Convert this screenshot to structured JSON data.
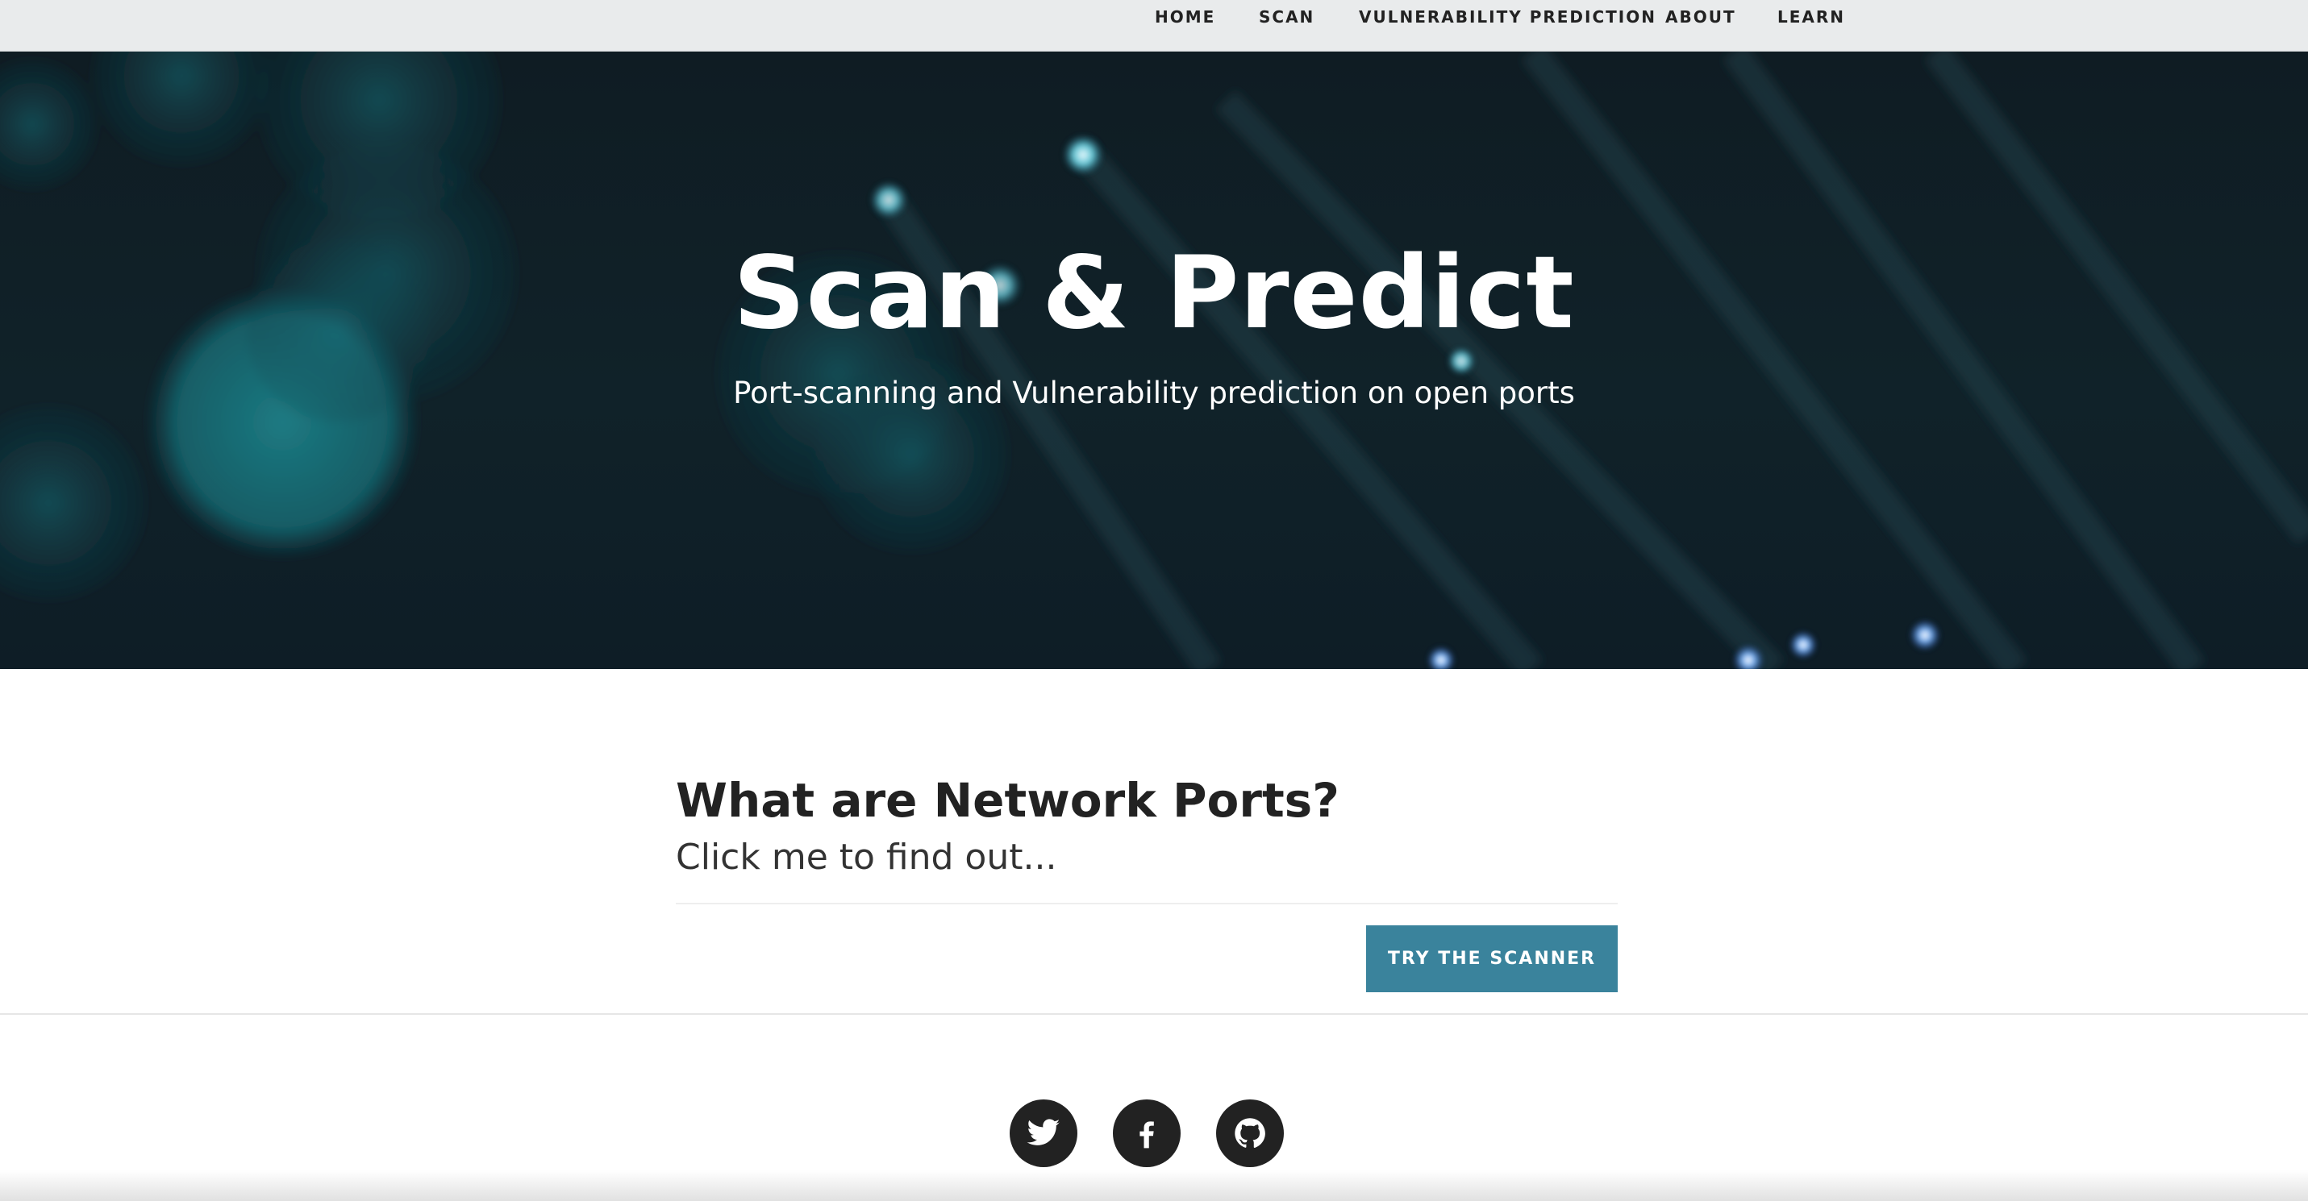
{
  "nav": {
    "items": [
      {
        "label": "HOME"
      },
      {
        "label": "SCAN"
      },
      {
        "label": "VULNERABILITY PREDICTION"
      },
      {
        "label": "ABOUT"
      },
      {
        "label": "LEARN"
      }
    ]
  },
  "hero": {
    "title": "Scan & Predict",
    "subtitle": "Port-scanning and Vulnerability prediction on open ports"
  },
  "post": {
    "title": "What are Network Ports?",
    "subtitle": "Click me to find out..."
  },
  "cta": {
    "label": "TRY THE SCANNER"
  },
  "social": {
    "icons": [
      "twitter-icon",
      "facebook-icon",
      "github-icon"
    ]
  },
  "colors": {
    "accent": "#3a839c",
    "text_dark": "#222222",
    "hero_bg": "#102229"
  }
}
